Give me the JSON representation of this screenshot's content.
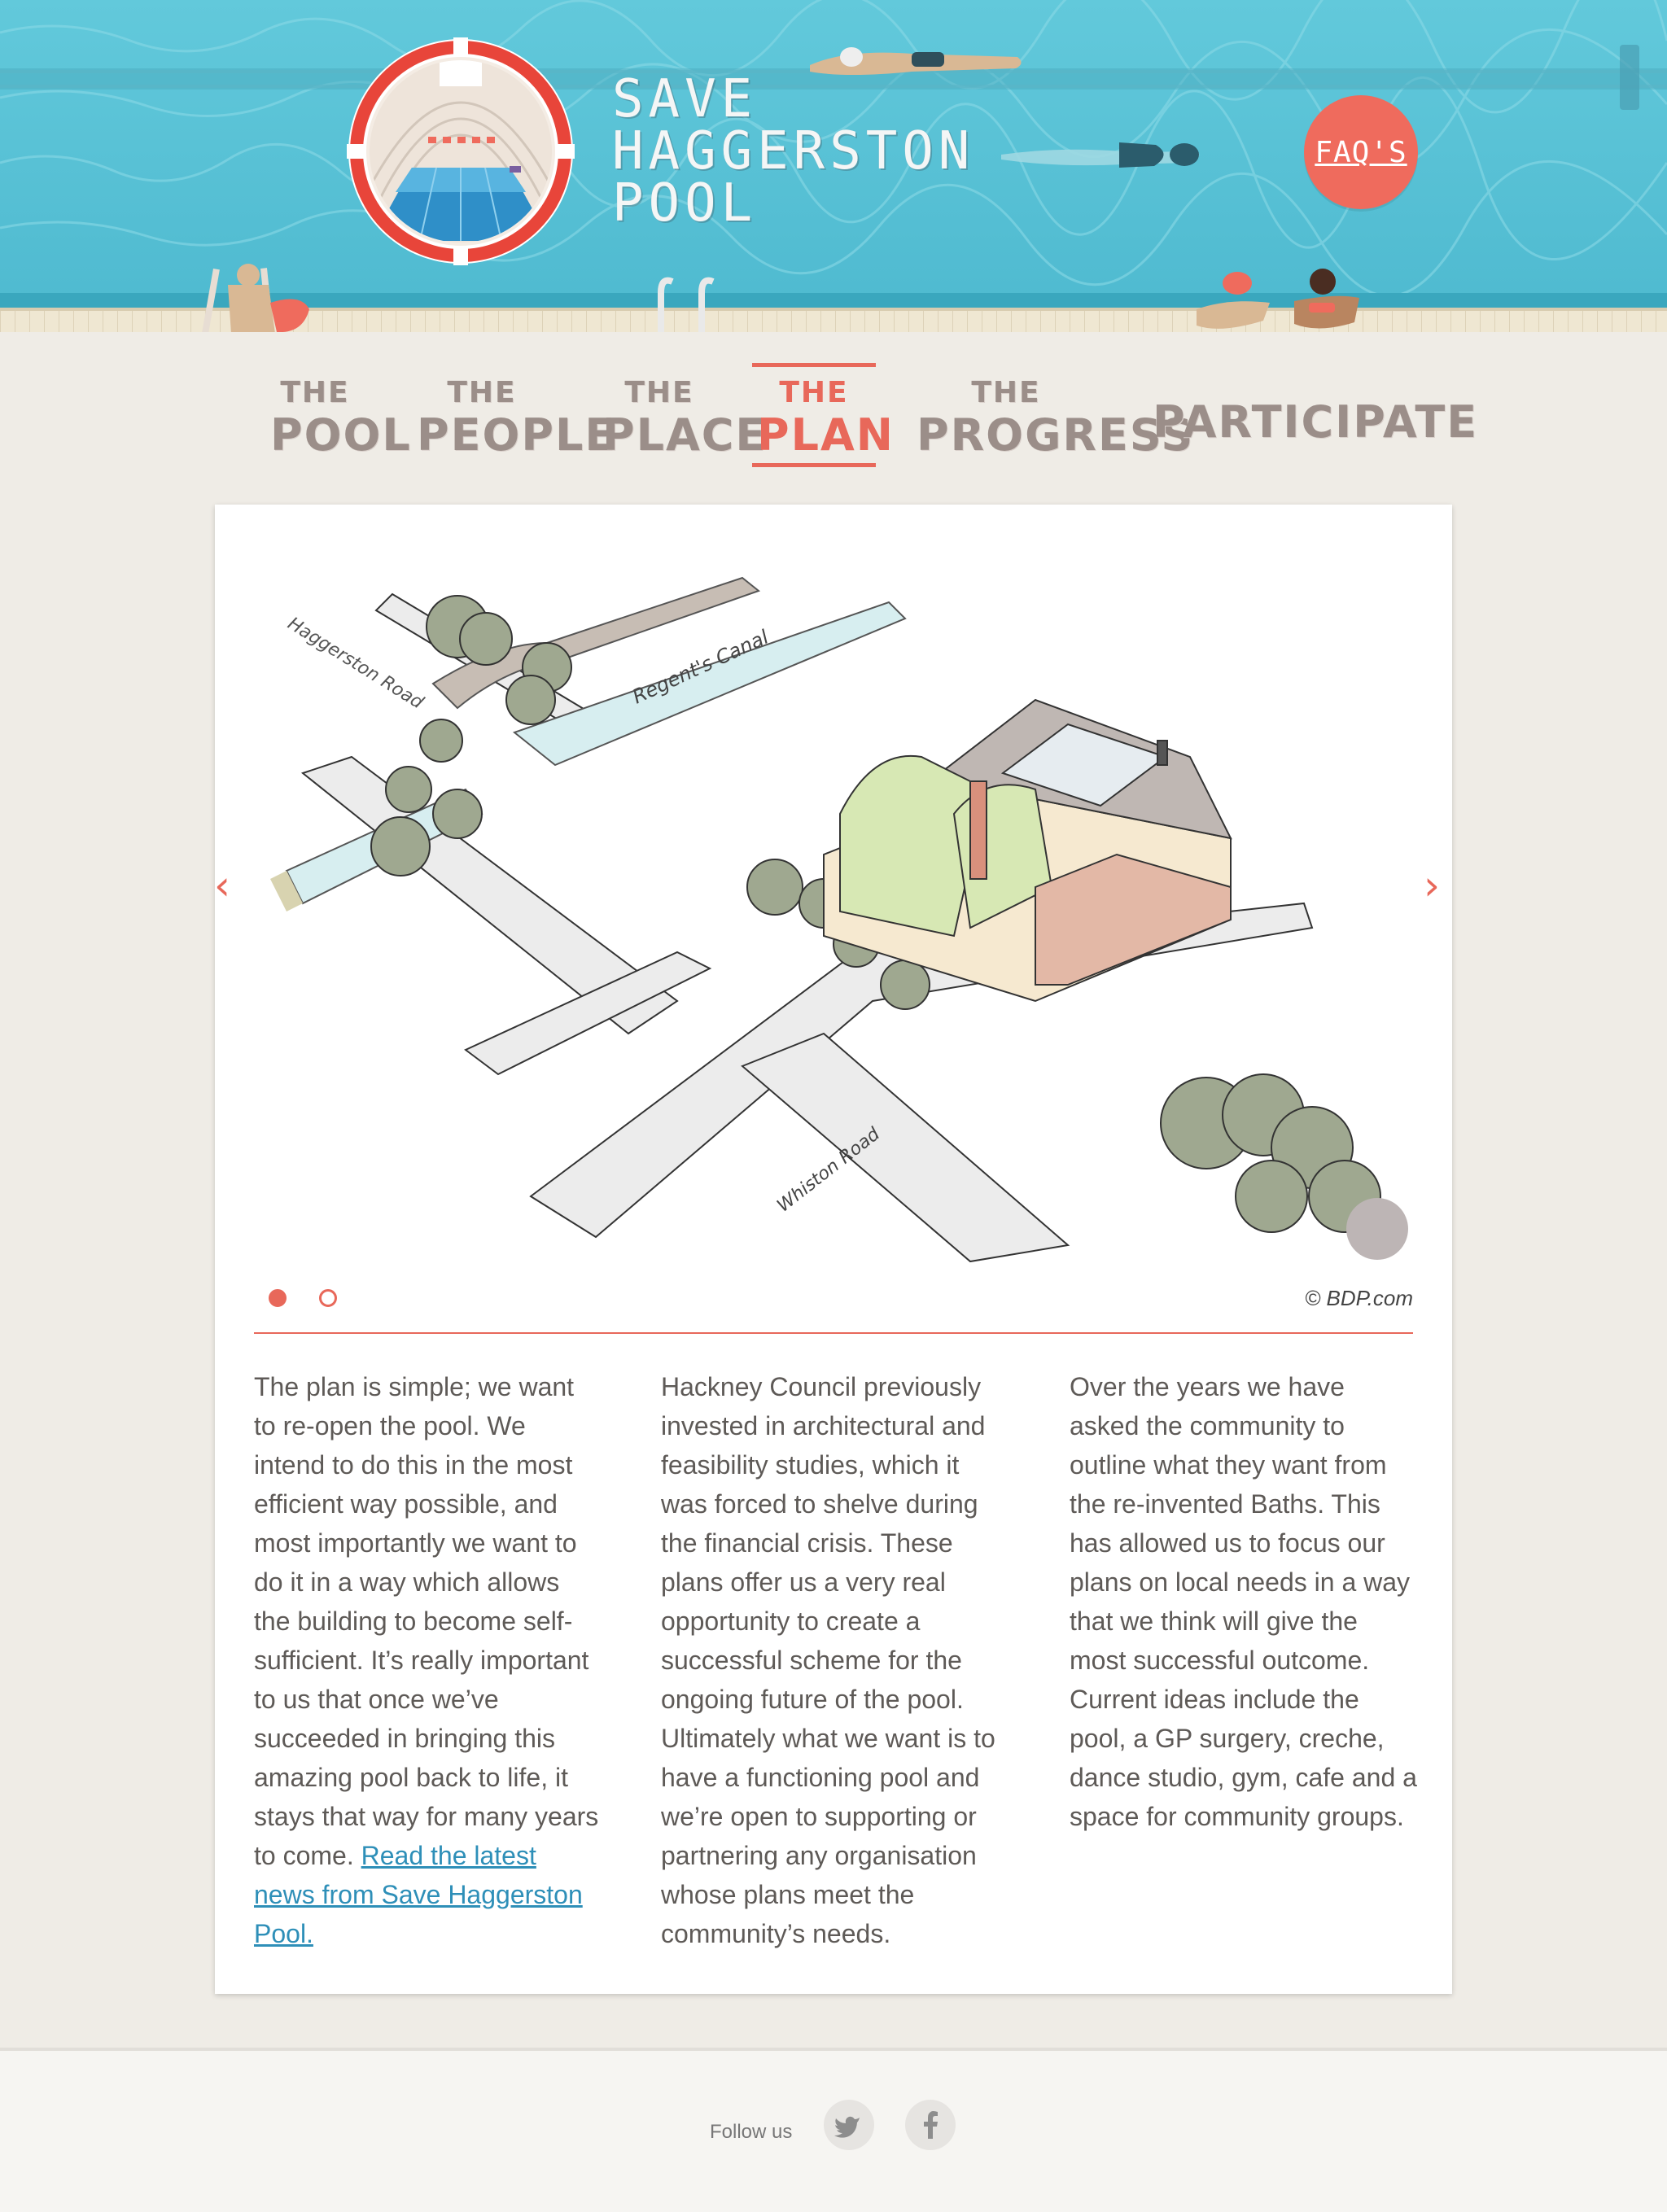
{
  "header": {
    "title_lines": [
      "SAVE",
      "HAGGERSTON",
      "POOL"
    ],
    "faq_label": "FAQ'S"
  },
  "nav": {
    "items": [
      {
        "the": "THE",
        "word": "POOL"
      },
      {
        "the": "THE",
        "word": "PEOPLE"
      },
      {
        "the": "THE",
        "word": "PLACE"
      },
      {
        "the": "THE",
        "word": "PLAN"
      },
      {
        "the": "THE",
        "word": "PROGRESS"
      },
      {
        "the": "",
        "word": "PARTICIPATE"
      }
    ],
    "active_index": 3
  },
  "slider": {
    "prev_label": "‹",
    "next_label": "›",
    "slide_count": 2,
    "active_slide": 1,
    "credit": "© BDP.com",
    "sketch_labels": {
      "road_1": "Haggerston Road",
      "canal": "Regent's Canal",
      "road_2": "Whiston Road"
    }
  },
  "content": {
    "col1_text": "The plan is simple; we want to re-open the pool. We intend to do this in the most efficient way possible, and most importantly we want to do it in a way which allows the building to become self-sufficient. It’s really important to us that once we’ve succeeded in bringing this amazing pool back to life, it stays that way for many years to come. ",
    "col1_link": "Read the latest news from Save Haggerston Pool.",
    "col2_text": "Hackney Council previously invested in architectural and feasibility studies, which it was forced to shelve during the financial crisis. These plans offer us a very real opportunity to create a successful scheme for the ongoing future of the pool. Ultimately what we want is to have a functioning pool and we’re open to supporting or partnering any organisation whose plans meet the community’s needs.",
    "col3_text": "Over the years we have asked the community to outline what they want from the re-invented Baths. This has allowed us to focus our plans on local needs in a way that we think will give the most successful outcome. Current ideas include the pool, a GP surgery, creche, dance studio, gym, cafe and a space for community groups."
  },
  "footer": {
    "follow_label": "Follow us",
    "social": [
      "twitter-icon",
      "facebook-icon"
    ]
  },
  "colors": {
    "accent": "#e8685a",
    "water": "#56c3d6",
    "link": "#2e8fb8",
    "nav_text": "#9b8e89",
    "background": "#efece6"
  }
}
